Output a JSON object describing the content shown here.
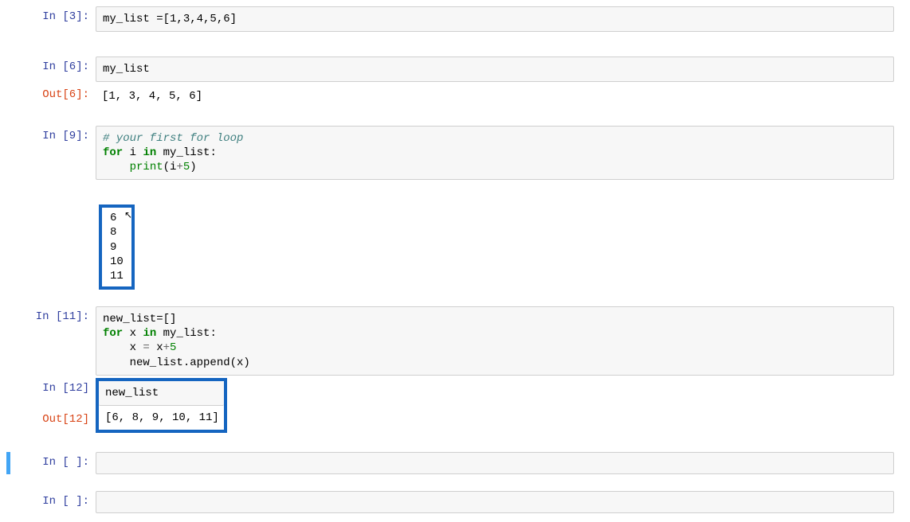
{
  "cells": {
    "c0": {
      "prompt_in": "In [3]:",
      "code_plain": "my_list =[1,3,4,5,6]"
    },
    "c1": {
      "prompt_in": "In [6]:",
      "code_plain": "my_list",
      "prompt_out": "Out[6]:",
      "output": "[1, 3, 4, 5, 6]"
    },
    "c2": {
      "prompt_in": "In [9]:",
      "comment": "# your first for loop",
      "line2_for": "for",
      "line2_var": " i ",
      "line2_in": "in",
      "line2_rest": " my_list:",
      "line3_indent": "    ",
      "line3_print": "print",
      "line3_open": "(i",
      "line3_op": "+",
      "line3_num": "5",
      "line3_close": ")",
      "output": "6\n8\n9\n10\n11"
    },
    "c3": {
      "prompt_in": "In [11]:",
      "line1": "new_list=[]",
      "line2_for": "for",
      "line2_var": " x ",
      "line2_in": "in",
      "line2_rest": " my_list:",
      "line3_indent": "    x ",
      "line3_op1": "=",
      "line3_mid": " x",
      "line3_op2": "+",
      "line3_num": "5",
      "line4": "    new_list.append(x)"
    },
    "c4": {
      "prompt_in": "In [12]",
      "code_plain": "new_list",
      "prompt_out": "Out[12]",
      "output": "[6, 8, 9, 10, 11]"
    },
    "c5": {
      "prompt_in": "In [ ]:"
    },
    "c6": {
      "prompt_in": "In [ ]:"
    }
  }
}
